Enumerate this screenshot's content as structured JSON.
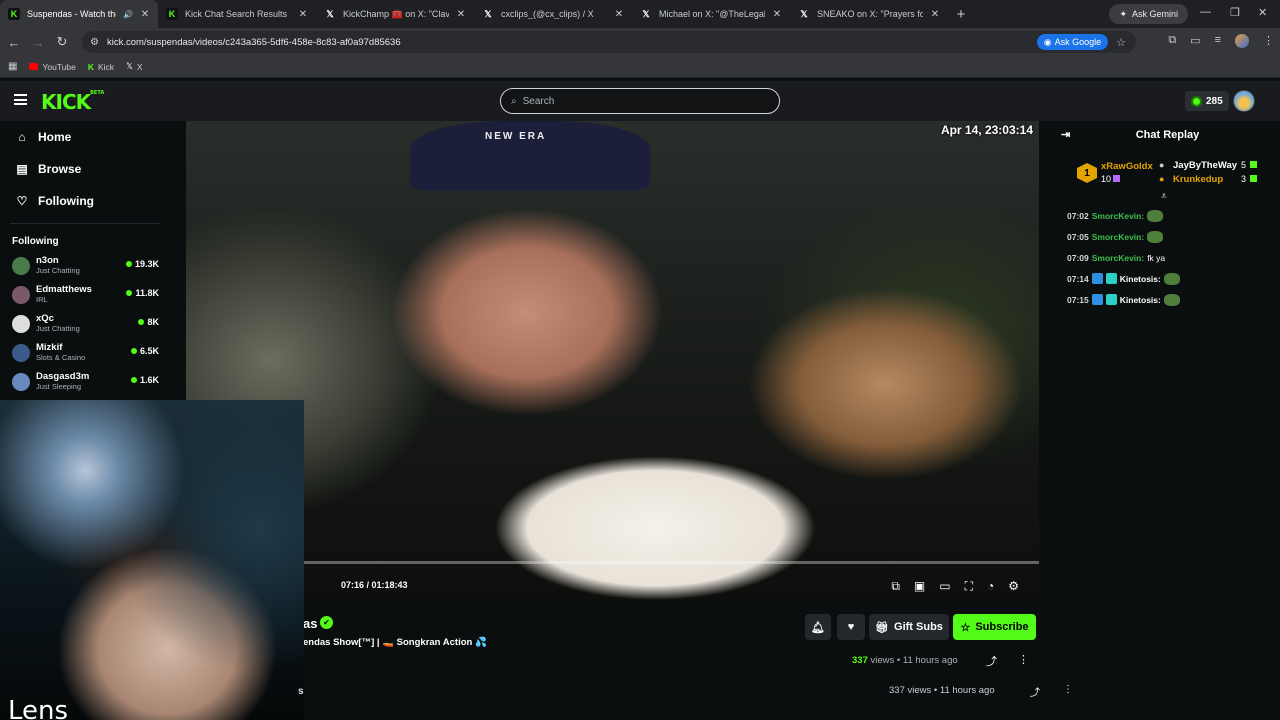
{
  "browser": {
    "tabs": [
      {
        "title": "Suspendas - Watch the VO",
        "icon": "K",
        "active": true
      },
      {
        "title": "Kick Chat Search Results",
        "icon": "K",
        "active": false
      },
      {
        "title": "KickChamp 🧰 on X: \"Clavicula",
        "icon": "X",
        "active": false
      },
      {
        "title": "cxclips_(@cx_clips) / X",
        "icon": "X",
        "active": false
      },
      {
        "title": "Michael on X: \"@TheLegalMind",
        "icon": "X",
        "active": false
      },
      {
        "title": "SNEAKO on X: \"Prayers for Clav",
        "icon": "X",
        "active": false
      }
    ],
    "new_tab": "+",
    "ask_gemini": "Ask Gemini",
    "url": "kick.com/suspendas/videos/c243a365-5df6-458e-8c83-af0a97d85636",
    "ask_google": "Ask Google",
    "bookmarks": [
      {
        "label": "YouTube"
      },
      {
        "label": "Kick"
      },
      {
        "label": "X"
      }
    ]
  },
  "kick": {
    "logo": "KICK",
    "logo_sup": "BETA",
    "search_placeholder": "Search",
    "points": "285"
  },
  "sidebar": {
    "nav": [
      {
        "label": "Home",
        "icon": "home-icon"
      },
      {
        "label": "Browse",
        "icon": "browse-icon"
      },
      {
        "label": "Following",
        "icon": "heart-icon"
      }
    ],
    "following_heading": "Following",
    "following": [
      {
        "name": "n3on",
        "category": "Just Chatting",
        "viewers": "19.3K",
        "color": "#4a7a4a"
      },
      {
        "name": "Edmatthews",
        "category": "IRL",
        "viewers": "11.8K",
        "color": "#7a5a6a"
      },
      {
        "name": "xQc",
        "category": "Just Chatting",
        "viewers": "8K",
        "color": "#dddddd"
      },
      {
        "name": "Mizkif",
        "category": "Slots & Casino",
        "viewers": "6.5K",
        "color": "#3a5a8a"
      },
      {
        "name": "Dasgasd3m",
        "category": "Just Sleeping",
        "viewers": "1.6K",
        "color": "#6a8abf"
      }
    ]
  },
  "video": {
    "timestamp": "Apr 14, 23:03:14",
    "cap_text": "NEW ERA",
    "time": "07:16 / 01:18:43",
    "progress": 0.092
  },
  "chat": {
    "title": "Chat Replay",
    "gifters": [
      {
        "name": "xRawGoldx",
        "count": "10",
        "color": "#e4a400"
      },
      {
        "name": "JayByTheWay",
        "count": "5",
        "color": "#ffffff"
      },
      {
        "name": "Krunkedup",
        "count": "3",
        "color": "#e4a400"
      }
    ],
    "messages": [
      {
        "time": "07:02",
        "user": "SmorcKevin:",
        "text": "",
        "emote": true
      },
      {
        "time": "07:05",
        "user": "SmorcKevin:",
        "text": "",
        "emote": true
      },
      {
        "time": "07:09",
        "user": "SmorcKevin:",
        "text": "fk ya",
        "emote": false
      },
      {
        "time": "07:14",
        "user": "Kinetosis:",
        "text": "",
        "emote": true,
        "badges": true
      },
      {
        "time": "07:15",
        "user": "Kinetosis:",
        "text": "",
        "emote": true,
        "badges": true
      }
    ]
  },
  "info": {
    "channel_partial": "as",
    "title_partial": "endas Show[™] | 🚤 Songkran Action 💦",
    "gift_subs": "Gift Subs",
    "subscribe": "Subscribe",
    "views_num": "337",
    "views_label": "views",
    "ago": "11 hours ago",
    "ghost_views": "337 views",
    "ghost_ago": "11 hours ago",
    "ghost_sh": "sh"
  },
  "overlay": {
    "bigtext": "Lens"
  }
}
